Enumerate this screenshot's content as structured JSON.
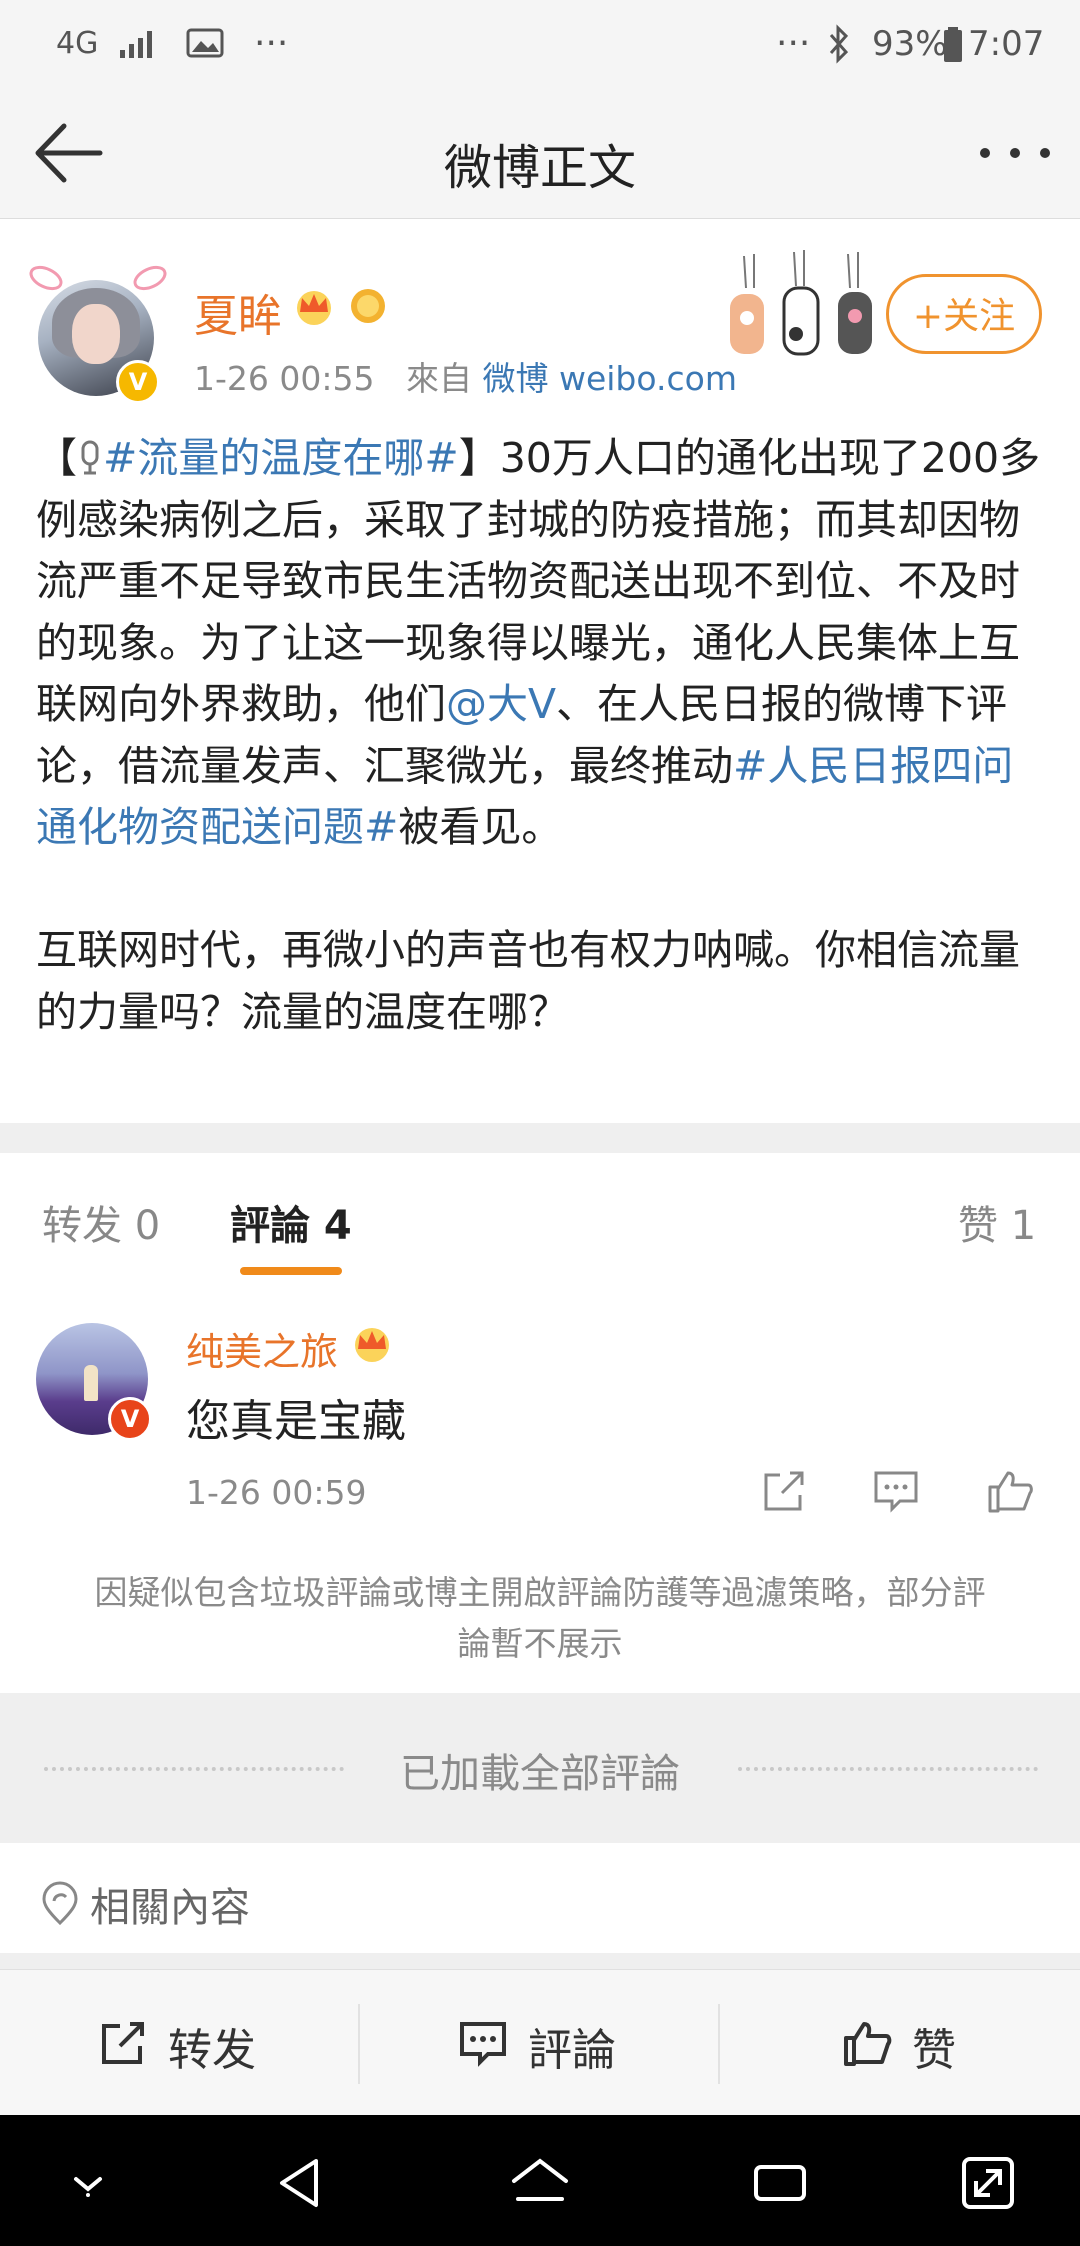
{
  "status_bar": {
    "network": "4G",
    "dots_left": "···",
    "dots_right": "···",
    "battery": "93%",
    "time": "7:07"
  },
  "header": {
    "title": "微博正文"
  },
  "post": {
    "author": "夏眸",
    "time": "1-26 00:55",
    "from_prefix": "來自",
    "source": "微博 weibo.com",
    "follow_label": "关注",
    "follow_plus": "+",
    "verified_badge": "V",
    "text_1": "【",
    "hashtag_1": "#流量的温度在哪#",
    "text_2": "】30万人口的通化出现了200多例感染病例之后，采取了封城的防疫措施；而其却因物流严重不足导致市民生活物资配送出现不到位、不及时的现象。为了让这一现象得以曝光，通化人民集体上互联网向外界救助，他们",
    "mention": "@大V",
    "text_3": "、在人民日报的微博下评论，借流量发声、汇聚微光，最终推动",
    "hashtag_2": "#人民日报四问通化物资配送问题#",
    "text_4": "被看见。",
    "paragraph_2": "互联网时代，再微小的声音也有权力呐喊。你相信流量的力量吗？流量的温度在哪？"
  },
  "tabs": {
    "repost": "转发 0",
    "comments": "評論 4",
    "likes": "赞 1"
  },
  "comment": {
    "name": "纯美之旅",
    "text": "您真是宝藏",
    "time": "1-26 00:59",
    "verified_badge": "V"
  },
  "notice": "因疑似包含垃圾評論或博主開啟評論防護等過濾策略，部分評論暫不展示",
  "loaded_all": "已加載全部評論",
  "related": "相關內容",
  "actions": {
    "repost": "转发",
    "comment": "評論",
    "like": "赞"
  },
  "colors": {
    "accent_orange": "#f08a1a",
    "link_blue": "#3b78b4",
    "author_orange": "#e8742a"
  }
}
